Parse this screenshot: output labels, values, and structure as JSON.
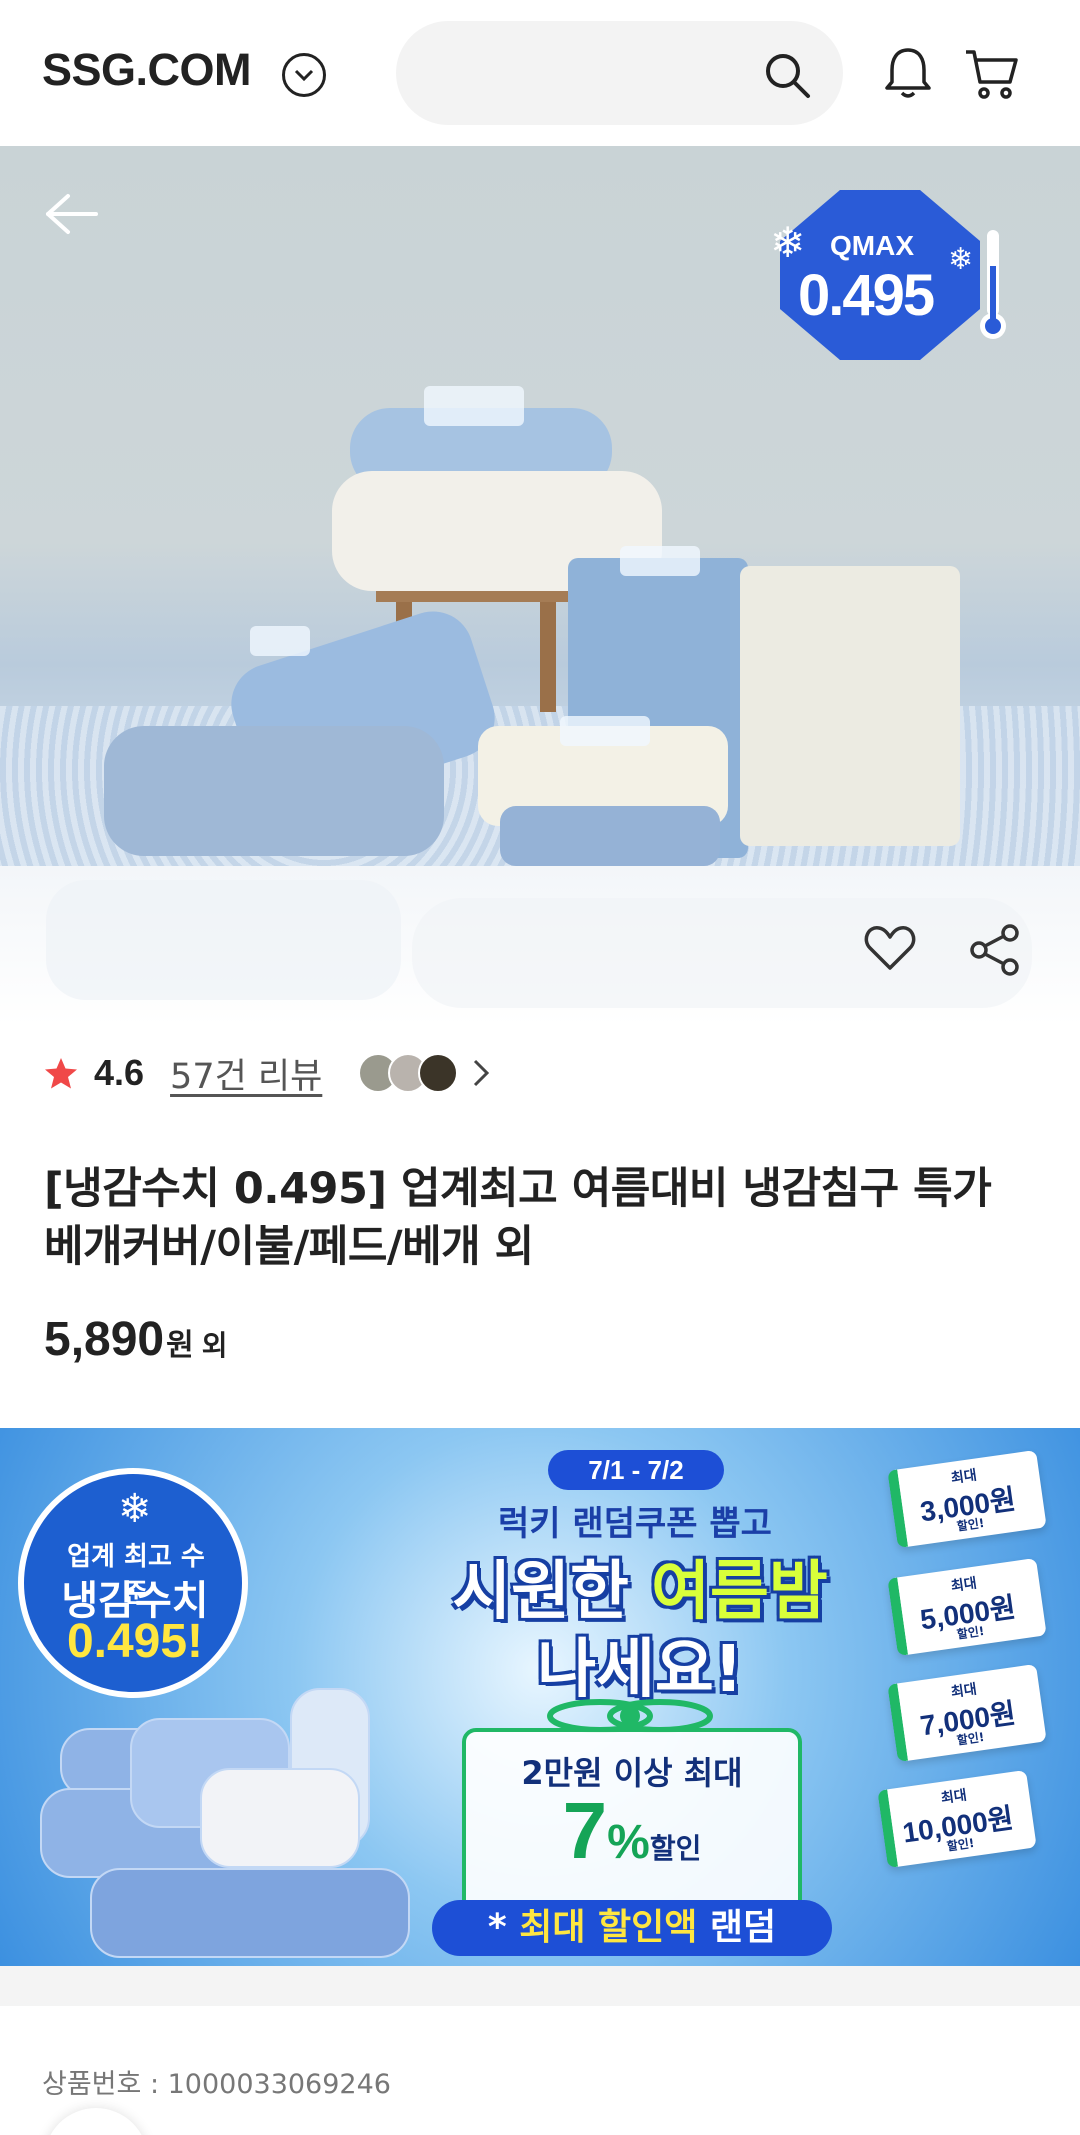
{
  "header": {
    "logo": "SSG.COM",
    "search_placeholder": "",
    "icons": [
      "chevron-down-icon",
      "search-icon",
      "bell-icon",
      "cart-icon"
    ]
  },
  "hero": {
    "badge_label": "QMAX",
    "badge_value": "0.495",
    "icons": [
      "back-arrow-icon",
      "heart-icon",
      "share-icon"
    ]
  },
  "rating": {
    "score": "4.6",
    "review_link": "57건 리뷰"
  },
  "product": {
    "title": "[냉감수치 0.495] 업계최고 여름대비 냉감침구 특가 베개커버/이불/페드/베개 외",
    "price_number": "5,890",
    "price_unit": "원",
    "price_suffix": "외",
    "product_no": "상품번호 : 1000033069246"
  },
  "banner": {
    "circle_line1": "업계 최고 수준",
    "circle_line2": "냉감수치",
    "circle_line3": "0.495!",
    "date": "7/1 - 7/2",
    "subtitle": "럭키 랜덤쿠폰 뽑고",
    "headline_a": "시원한 ",
    "headline_b": "여름밤",
    "headline_c": "나세요!",
    "gift_line1": "2만원 이상 최대",
    "gift_pct_num": "7",
    "gift_pct_sign": "%",
    "gift_pct_word": "할인",
    "bottom_a": "* ",
    "bottom_b": "최대 할인액",
    "bottom_c": " 랜덤",
    "coupons": [
      {
        "top": "최대",
        "amount": "3,000원",
        "sub": "할인!"
      },
      {
        "top": "최대",
        "amount": "5,000원",
        "sub": "할인!"
      },
      {
        "top": "최대",
        "amount": "7,000원",
        "sub": "할인!"
      },
      {
        "top": "최대",
        "amount": "10,000원",
        "sub": "할인!"
      }
    ]
  },
  "colors": {
    "star": "#f04848",
    "banner_blue": "#1d4fd6",
    "banner_green": "#20b866",
    "banner_yellow": "#d9ff3a"
  }
}
